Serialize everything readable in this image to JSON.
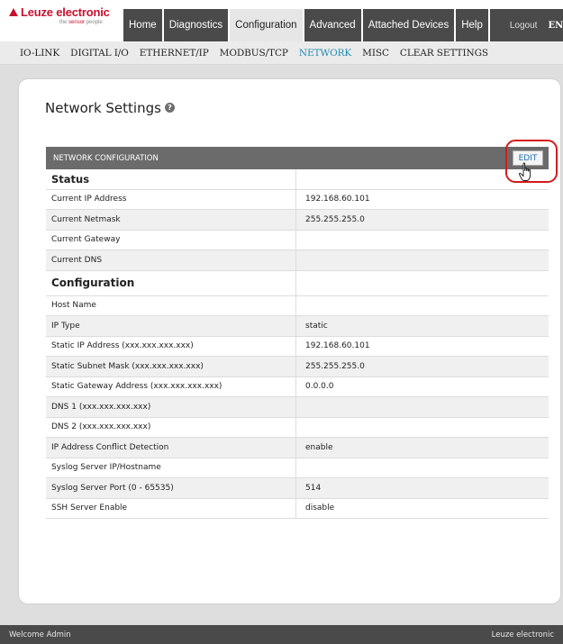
{
  "header": {
    "logo_text": "Leuze electronic",
    "logo_sub_a": "the",
    "logo_sub_b": "sensor",
    "logo_sub_c": "people",
    "tabs": [
      {
        "label": "Home"
      },
      {
        "label": "Diagnostics"
      },
      {
        "label": "Configuration",
        "active": true
      },
      {
        "label": "Advanced"
      },
      {
        "label": "Attached Devices"
      },
      {
        "label": "Help"
      }
    ],
    "logout_label": "Logout",
    "lang_label": "EN"
  },
  "subnav": {
    "items": [
      {
        "label": "IO-LINK"
      },
      {
        "label": "DIGITAL I/O"
      },
      {
        "label": "ETHERNET/IP"
      },
      {
        "label": "MODBUS/TCP"
      },
      {
        "label": "NETWORK",
        "active": true
      },
      {
        "label": "MISC"
      },
      {
        "label": "CLEAR SETTINGS"
      }
    ]
  },
  "page": {
    "title": "Network Settings",
    "help_glyph": "?"
  },
  "table": {
    "header": "NETWORK CONFIGURATION",
    "edit_label": "EDIT",
    "rows": [
      {
        "type": "section",
        "label": "Status",
        "value": ""
      },
      {
        "label": "Current IP Address",
        "value": "192.168.60.101"
      },
      {
        "label": "Current Netmask",
        "value": "255.255.255.0"
      },
      {
        "label": "Current Gateway",
        "value": ""
      },
      {
        "label": "Current DNS",
        "value": ""
      },
      {
        "type": "section",
        "label": "Configuration",
        "value": ""
      },
      {
        "label": "Host Name",
        "value": ""
      },
      {
        "label": "IP Type",
        "value": "static"
      },
      {
        "label": "Static IP Address (xxx.xxx.xxx.xxx)",
        "value": "192.168.60.101"
      },
      {
        "label": "Static Subnet Mask (xxx.xxx.xxx.xxx)",
        "value": "255.255.255.0"
      },
      {
        "label": "Static Gateway Address (xxx.xxx.xxx.xxx)",
        "value": "0.0.0.0"
      },
      {
        "label": "DNS 1 (xxx.xxx.xxx.xxx)",
        "value": ""
      },
      {
        "label": "DNS 2 (xxx.xxx.xxx.xxx)",
        "value": ""
      },
      {
        "label": "IP Address Conflict Detection",
        "value": "enable"
      },
      {
        "label": "Syslog Server IP/Hostname",
        "value": ""
      },
      {
        "label": "Syslog Server Port (0 - 65535)",
        "value": "514"
      },
      {
        "label": "SSH Server Enable",
        "value": "disable"
      }
    ]
  },
  "footer": {
    "left": "Welcome Admin",
    "right": "Leuze electronic"
  },
  "colors": {
    "brand_red": "#c8102e",
    "nav_dark": "#4a4a4a",
    "active_link": "#1f8bb0",
    "highlight_circle": "#d51b1b"
  }
}
